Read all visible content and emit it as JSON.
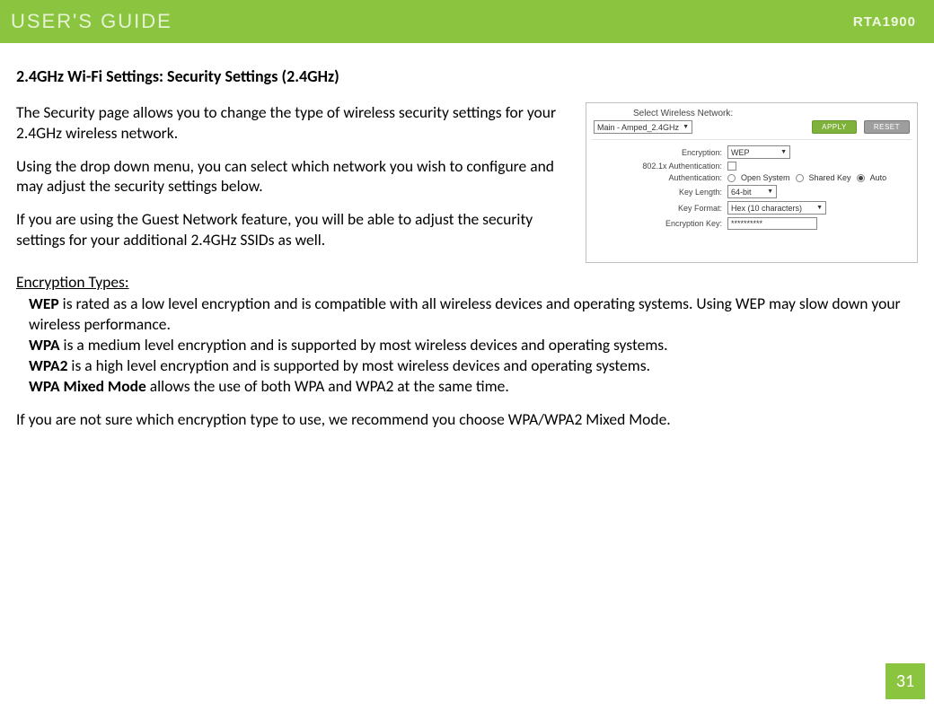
{
  "header": {
    "title": "USER'S GUIDE",
    "model": "RTA1900"
  },
  "section_heading": "2.4GHz Wi-Fi Settings: Security Settings (2.4GHz)",
  "intro": {
    "p1": "The Security page allows you to change the type of wireless security settings for your 2.4GHz wireless network.",
    "p2": "Using the drop down menu, you can select which network you wish to configure and may adjust the security settings below.",
    "p3": "If you are using the Guest Network feature, you will be able to adjust the security settings for your additional 2.4GHz SSIDs as well."
  },
  "panel": {
    "select_label": "Select Wireless Network:",
    "select_value": "Main - Amped_2.4GHz",
    "apply": "APPLY",
    "reset": "RESET",
    "rows": {
      "encryption_label": "Encryption:",
      "encryption_value": "WEP",
      "auth8021x_label": "802.1x Authentication:",
      "auth_label": "Authentication:",
      "auth_options": {
        "open": "Open System",
        "shared": "Shared Key",
        "auto": "Auto"
      },
      "keylen_label": "Key Length:",
      "keylen_value": "64-bit",
      "keyfmt_label": "Key Format:",
      "keyfmt_value": "Hex (10 characters)",
      "enckey_label": "Encryption Key:",
      "enckey_value": "**********"
    }
  },
  "enc_heading": "Encryption Types:",
  "enc": {
    "wep_bold": "WEP",
    "wep_text": " is rated as a low level encryption and is compatible with all wireless devices and operating systems. Using WEP may slow down your wireless performance.",
    "wpa_bold": "WPA",
    "wpa_text": " is a medium level encryption and is supported by most wireless devices and operating systems.",
    "wpa2_bold": "WPA2",
    "wpa2_text": " is a high level encryption and is supported by most wireless devices and operating systems.",
    "mixed_bold": "WPA Mixed Mode",
    "mixed_text": " allows the use of both WPA and WPA2 at the same time."
  },
  "final_note": "If you are not sure which encryption type to use, we recommend you choose WPA/WPA2 Mixed Mode.",
  "page_number": "31"
}
